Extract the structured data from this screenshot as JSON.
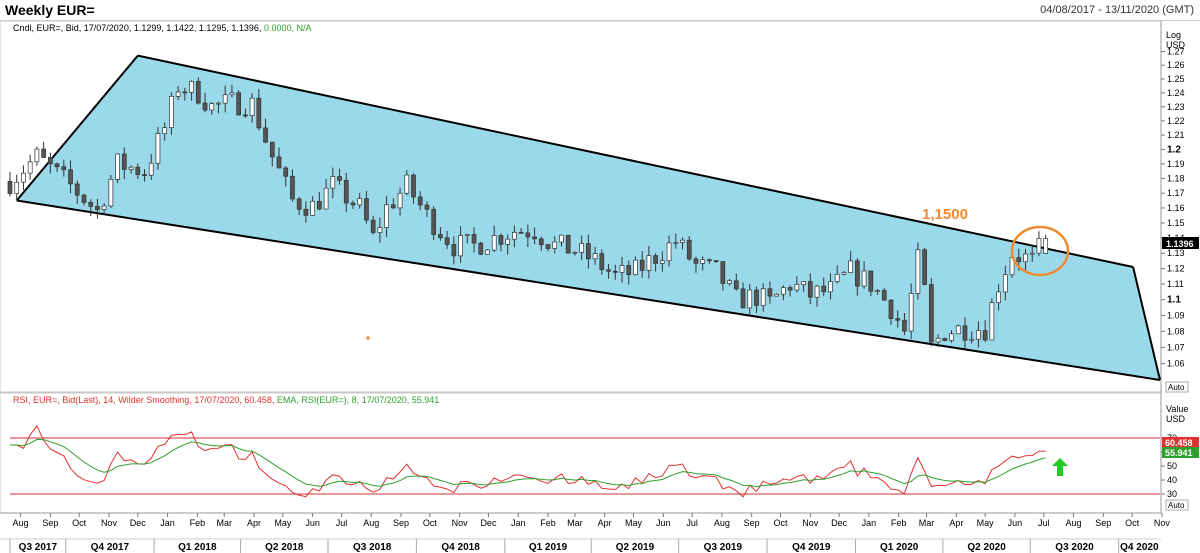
{
  "header": {
    "title": "Weekly EUR=",
    "range": "04/08/2017 - 13/11/2020 (GMT)"
  },
  "price_panel": {
    "info_prefix": "Cndl, EUR=, Bid, 17/07/2020, 1.1299, 1.1422, 1.1295, 1.1396,",
    "info_change": "0.0000, N/A",
    "scale_label_1": "Log",
    "scale_label_2": "USD",
    "last_price_label": "1.1396",
    "annotation": "1,1500",
    "auto_label": "Auto"
  },
  "rsi_panel": {
    "info_rsi": "RSI, EUR=, Bid(Last), 14, Wilder Smoothing, 17/07/2020, 60.458,",
    "info_ema": "EMA, RSI(EUR=), 8, 17/07/2020, 55.941",
    "scale_label_1": "Value",
    "scale_label_2": "USD",
    "rsi_label": "60.458",
    "ema_label": "55.941",
    "auto_label": "Auto"
  },
  "colors": {
    "channel_fill": "#9ad9ea",
    "up_candle": "#ffffff",
    "down_candle": "#555555",
    "rsi_line": "#e03030",
    "ema_line": "#2ea02e",
    "annotation": "#f08a30",
    "arrow": "#22cc22",
    "bound_line": "#cc3333"
  },
  "chart_data": {
    "type": "candlestick",
    "scale": "log",
    "ylim": [
      1.05,
      1.28
    ],
    "y_ticks": [
      1.27,
      1.26,
      1.25,
      1.24,
      1.23,
      1.22,
      1.21,
      1.2,
      1.19,
      1.18,
      1.17,
      1.16,
      1.15,
      1.14,
      1.13,
      1.12,
      1.11,
      1.1,
      1.09,
      1.08,
      1.07,
      1.06
    ],
    "y_ticks_bold": [
      1.2,
      1.1
    ],
    "months": [
      "Aug",
      "Sep",
      "Oct",
      "Nov",
      "Dec",
      "Jan",
      "Feb",
      "Mar",
      "Apr",
      "May",
      "Jun",
      "Jul",
      "Aug",
      "Sep",
      "Oct",
      "Nov",
      "Dec",
      "Jan",
      "Feb",
      "Mar",
      "Apr",
      "May",
      "Jun",
      "Jul",
      "Aug",
      "Sep",
      "Oct",
      "Nov",
      "Dec",
      "Jan",
      "Feb",
      "Mar",
      "Apr",
      "May",
      "Jun",
      "Jul",
      "Aug",
      "Sep",
      "Oct",
      "Nov"
    ],
    "quarters": [
      "Q3 2017",
      "Q4 2017",
      "Q1 2018",
      "Q2 2018",
      "Q3 2018",
      "Q4 2018",
      "Q1 2019",
      "Q2 2019",
      "Q3 2019",
      "Q4 2019",
      "Q1 2020",
      "Q2 2020",
      "Q3 2020",
      "Q4 2020"
    ],
    "x_range": [
      "2017-08-04",
      "2020-11-13"
    ],
    "last_candle": {
      "date": "2020-07-17",
      "open": 1.1299,
      "high": 1.1422,
      "low": 1.1295,
      "close": 1.1396
    },
    "channel": {
      "upper": [
        {
          "date": "2017-12-15",
          "price": 1.267
        },
        {
          "date": "2020-10-16",
          "price": 1.121
        }
      ],
      "lower": [
        {
          "date": "2017-08-11",
          "price": 1.165
        },
        {
          "date": "2020-11-13",
          "price": 1.05
        }
      ]
    },
    "close_path": [
      [
        "2017-08-04",
        1.178
      ],
      [
        "2017-09-01",
        1.195
      ],
      [
        "2017-10-06",
        1.175
      ],
      [
        "2017-11-03",
        1.158
      ],
      [
        "2017-11-24",
        1.19
      ],
      [
        "2017-12-22",
        1.185
      ],
      [
        "2018-01-12",
        1.215
      ],
      [
        "2018-01-26",
        1.245
      ],
      [
        "2018-02-16",
        1.24
      ],
      [
        "2018-03-02",
        1.23
      ],
      [
        "2018-03-23",
        1.233
      ],
      [
        "2018-04-13",
        1.232
      ],
      [
        "2018-05-04",
        1.195
      ],
      [
        "2018-05-25",
        1.165
      ],
      [
        "2018-06-15",
        1.161
      ],
      [
        "2018-07-06",
        1.175
      ],
      [
        "2018-08-03",
        1.16
      ],
      [
        "2018-08-17",
        1.14
      ],
      [
        "2018-08-31",
        1.16
      ],
      [
        "2018-09-21",
        1.175
      ],
      [
        "2018-10-12",
        1.155
      ],
      [
        "2018-11-09",
        1.135
      ],
      [
        "2018-11-30",
        1.135
      ],
      [
        "2018-12-21",
        1.14
      ],
      [
        "2019-01-11",
        1.145
      ],
      [
        "2019-02-01",
        1.145
      ],
      [
        "2019-02-22",
        1.135
      ],
      [
        "2019-03-15",
        1.132
      ],
      [
        "2019-04-05",
        1.125
      ],
      [
        "2019-04-26",
        1.115
      ],
      [
        "2019-05-17",
        1.118
      ],
      [
        "2019-06-07",
        1.128
      ],
      [
        "2019-06-28",
        1.138
      ],
      [
        "2019-07-19",
        1.122
      ],
      [
        "2019-08-09",
        1.118
      ],
      [
        "2019-08-30",
        1.1
      ],
      [
        "2019-09-20",
        1.102
      ],
      [
        "2019-10-04",
        1.098
      ],
      [
        "2019-10-25",
        1.11
      ],
      [
        "2019-11-15",
        1.103
      ],
      [
        "2019-12-06",
        1.106
      ],
      [
        "2019-12-27",
        1.118
      ],
      [
        "2020-01-17",
        1.11
      ],
      [
        "2020-02-07",
        1.095
      ],
      [
        "2020-02-21",
        1.08
      ],
      [
        "2020-03-06",
        1.125
      ],
      [
        "2020-03-13",
        1.105
      ],
      [
        "2020-03-20",
        1.07
      ],
      [
        "2020-04-03",
        1.08
      ],
      [
        "2020-04-24",
        1.082
      ],
      [
        "2020-05-15",
        1.082
      ],
      [
        "2020-05-29",
        1.11
      ],
      [
        "2020-06-12",
        1.13
      ],
      [
        "2020-07-03",
        1.125
      ],
      [
        "2020-07-17",
        1.1396
      ]
    ],
    "rsi": {
      "ylim": [
        20,
        90
      ],
      "upper_bound": 70,
      "lower_bound": 30,
      "y_ticks": [
        70,
        60,
        50,
        40,
        30
      ],
      "last_rsi": 60.458,
      "last_ema": 55.941
    }
  }
}
